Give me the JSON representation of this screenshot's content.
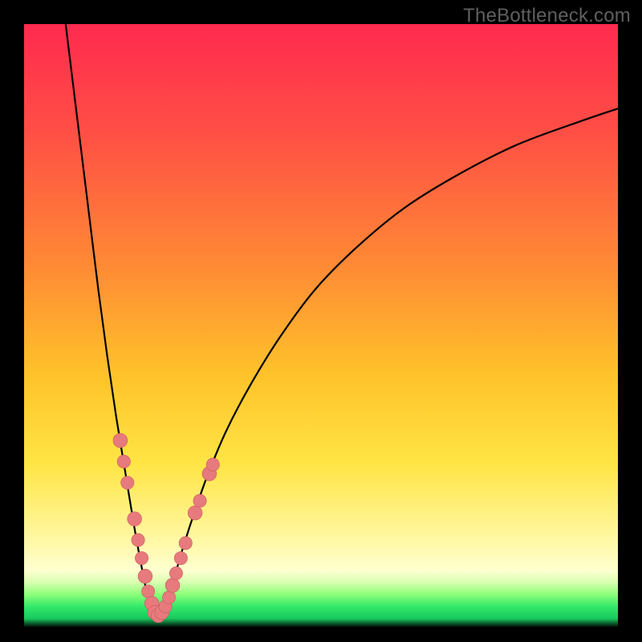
{
  "watermark": "TheBottleneck.com",
  "colors": {
    "black": "#000000",
    "curve": "#000000",
    "dot_fill": "#e77a7d",
    "dot_stroke": "#c9595e"
  },
  "chart_data": {
    "type": "line",
    "title": "",
    "xlabel": "",
    "ylabel": "",
    "xlim": [
      0,
      100
    ],
    "ylim": [
      0,
      100
    ],
    "grid": false,
    "note": "Gradient background: red→orange→yellow→pale-yellow with green strip at bottom. Curve is a V shape (minimum ≈ x 22, y 2). Left branch steep, right branch shallower and convex. Salmon data points cluster around the trough.",
    "background_gradient_stops": [
      {
        "offset": 0.0,
        "color": "#ff2a4f"
      },
      {
        "offset": 0.18,
        "color": "#ff4f45"
      },
      {
        "offset": 0.4,
        "color": "#ff8a35"
      },
      {
        "offset": 0.58,
        "color": "#ffc22a"
      },
      {
        "offset": 0.73,
        "color": "#ffe545"
      },
      {
        "offset": 0.85,
        "color": "#fff7a0"
      },
      {
        "offset": 0.905,
        "color": "#ffffd0"
      },
      {
        "offset": 0.925,
        "color": "#d9ffb0"
      },
      {
        "offset": 0.945,
        "color": "#8dff7a"
      },
      {
        "offset": 0.965,
        "color": "#34e96a"
      },
      {
        "offset": 0.985,
        "color": "#17c95e"
      },
      {
        "offset": 1.0,
        "color": "#000000"
      }
    ],
    "curve_points": [
      {
        "x": 7.0,
        "y": 100.0
      },
      {
        "x": 8.0,
        "y": 92.0
      },
      {
        "x": 9.5,
        "y": 80.0
      },
      {
        "x": 11.0,
        "y": 68.0
      },
      {
        "x": 12.5,
        "y": 56.0
      },
      {
        "x": 14.0,
        "y": 45.0
      },
      {
        "x": 15.5,
        "y": 35.0
      },
      {
        "x": 17.0,
        "y": 26.0
      },
      {
        "x": 18.5,
        "y": 17.0
      },
      {
        "x": 20.0,
        "y": 9.0
      },
      {
        "x": 21.0,
        "y": 4.5
      },
      {
        "x": 22.0,
        "y": 2.0
      },
      {
        "x": 23.0,
        "y": 2.0
      },
      {
        "x": 24.0,
        "y": 4.0
      },
      {
        "x": 25.5,
        "y": 9.0
      },
      {
        "x": 27.0,
        "y": 14.0
      },
      {
        "x": 29.0,
        "y": 20.0
      },
      {
        "x": 31.0,
        "y": 25.5
      },
      {
        "x": 34.0,
        "y": 32.5
      },
      {
        "x": 38.0,
        "y": 40.0
      },
      {
        "x": 43.0,
        "y": 48.0
      },
      {
        "x": 49.0,
        "y": 56.0
      },
      {
        "x": 56.0,
        "y": 63.0
      },
      {
        "x": 64.0,
        "y": 69.5
      },
      {
        "x": 73.0,
        "y": 75.0
      },
      {
        "x": 83.0,
        "y": 80.0
      },
      {
        "x": 94.0,
        "y": 84.0
      },
      {
        "x": 100.0,
        "y": 86.0
      }
    ],
    "data_points": [
      {
        "x": 16.2,
        "y": 31.0,
        "r": 1.2
      },
      {
        "x": 16.8,
        "y": 27.5,
        "r": 1.1
      },
      {
        "x": 17.4,
        "y": 24.0,
        "r": 1.1
      },
      {
        "x": 18.6,
        "y": 18.0,
        "r": 1.2
      },
      {
        "x": 19.2,
        "y": 14.5,
        "r": 1.1
      },
      {
        "x": 19.8,
        "y": 11.5,
        "r": 1.1
      },
      {
        "x": 20.4,
        "y": 8.5,
        "r": 1.2
      },
      {
        "x": 20.9,
        "y": 6.0,
        "r": 1.1
      },
      {
        "x": 21.5,
        "y": 4.0,
        "r": 1.2
      },
      {
        "x": 22.0,
        "y": 2.5,
        "r": 1.2
      },
      {
        "x": 22.6,
        "y": 2.0,
        "r": 1.2
      },
      {
        "x": 23.2,
        "y": 2.5,
        "r": 1.2
      },
      {
        "x": 23.8,
        "y": 3.5,
        "r": 1.1
      },
      {
        "x": 24.4,
        "y": 5.0,
        "r": 1.1
      },
      {
        "x": 25.0,
        "y": 7.0,
        "r": 1.2
      },
      {
        "x": 25.6,
        "y": 9.0,
        "r": 1.1
      },
      {
        "x": 26.4,
        "y": 11.5,
        "r": 1.1
      },
      {
        "x": 27.2,
        "y": 14.0,
        "r": 1.1
      },
      {
        "x": 28.8,
        "y": 19.0,
        "r": 1.2
      },
      {
        "x": 29.6,
        "y": 21.0,
        "r": 1.1
      },
      {
        "x": 31.2,
        "y": 25.5,
        "r": 1.2
      },
      {
        "x": 31.8,
        "y": 27.0,
        "r": 1.1
      }
    ]
  }
}
